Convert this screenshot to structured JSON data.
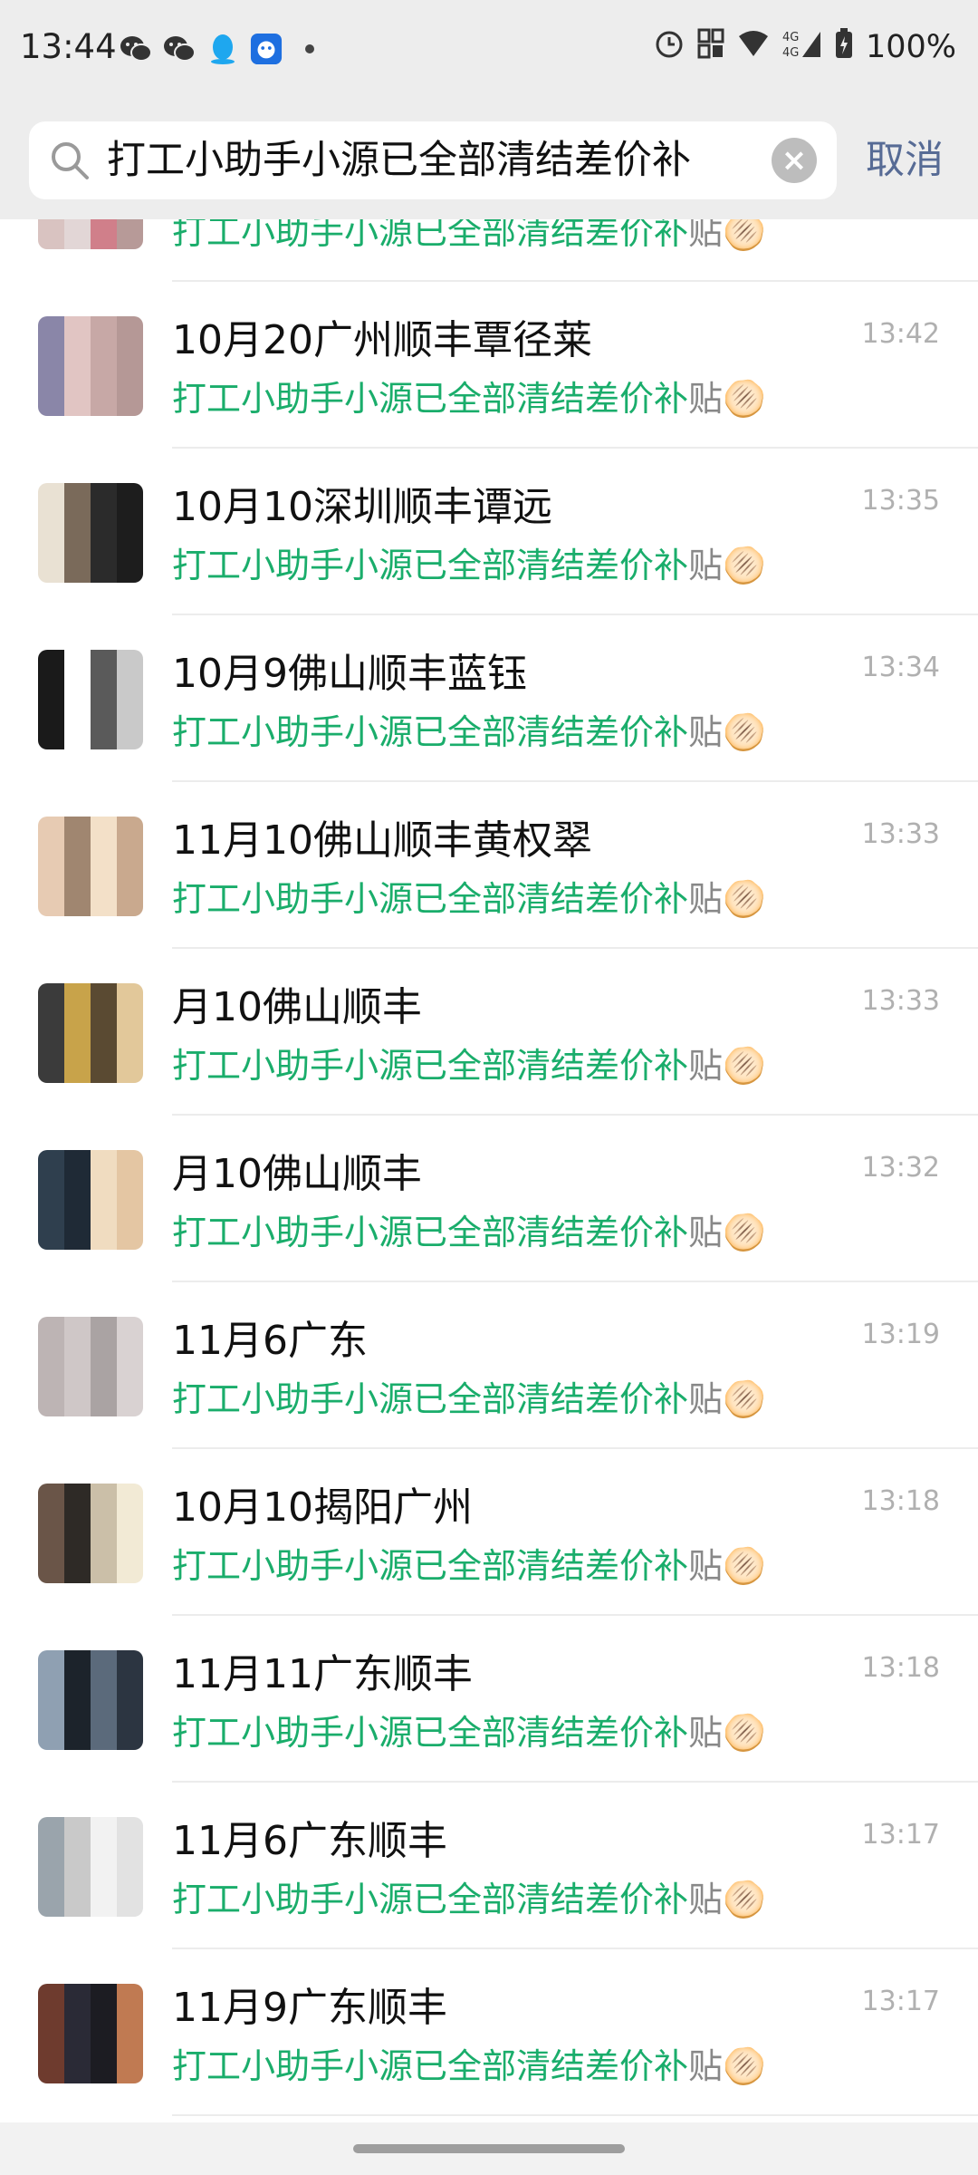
{
  "status_bar": {
    "time": "13:44",
    "left_icons": [
      "wechat-icon",
      "wechat-icon",
      "qq-icon",
      "app-icon",
      "dot-icon"
    ],
    "right_icons": [
      "alarm-icon",
      "nfc-icon",
      "wifi-icon",
      "signal-4g-icon",
      "battery-icon"
    ],
    "battery": "100%"
  },
  "search": {
    "query": "打工小助手小源已全部清结差价补",
    "cancel_label": "取消"
  },
  "results": [
    {
      "title": "",
      "time": "",
      "message": "打工小助手小源已全部清结差价补",
      "suffix": "贴🫓"
    },
    {
      "title": "10月20广州顺丰覃径莱",
      "time": "13:42",
      "message": "打工小助手小源已全部清结差价补",
      "suffix": "贴🫓"
    },
    {
      "title": "10月10深圳顺丰谭远",
      "time": "13:35",
      "message": "打工小助手小源已全部清结差价补",
      "suffix": "贴🫓"
    },
    {
      "title": "10月9佛山顺丰蓝钰",
      "time": "13:34",
      "message": "打工小助手小源已全部清结差价补",
      "suffix": "贴🫓"
    },
    {
      "title": "11月10佛山顺丰黄权翠",
      "time": "13:33",
      "message": "打工小助手小源已全部清结差价补",
      "suffix": "贴🫓"
    },
    {
      "title": "月10佛山顺丰",
      "time": "13:33",
      "message": "打工小助手小源已全部清结差价补",
      "suffix": "贴🫓"
    },
    {
      "title": "月10佛山顺丰",
      "time": "13:32",
      "message": "打工小助手小源已全部清结差价补",
      "suffix": "贴🫓"
    },
    {
      "title": "11月6广东",
      "time": "13:19",
      "message": "打工小助手小源已全部清结差价补",
      "suffix": "贴🫓"
    },
    {
      "title": "10月10揭阳广州",
      "time": "13:18",
      "message": "打工小助手小源已全部清结差价补",
      "suffix": "贴🫓"
    },
    {
      "title": "11月11广东顺丰",
      "time": "13:18",
      "message": "打工小助手小源已全部清结差价补",
      "suffix": "贴🫓"
    },
    {
      "title": "11月6广东顺丰",
      "time": "13:17",
      "message": "打工小助手小源已全部清结差价补",
      "suffix": "贴🫓"
    },
    {
      "title": "11月9广东顺丰",
      "time": "13:17",
      "message": "打工小助手小源已全部清结差价补",
      "suffix": "贴🫓"
    }
  ],
  "avatar_colors": [
    [
      "#d9c3c1",
      "#b79a98",
      "#d07f8a",
      "#e2d6d6"
    ],
    [
      "#b59896",
      "#c7a8a6",
      "#e1c5c3",
      "#8a86a8"
    ],
    [
      "#2b2b2b",
      "#7a6a5a",
      "#e9e1d3",
      "#1d1d1d"
    ],
    [
      "#ffffff",
      "#1a1a1a",
      "#c9c9c9",
      "#5a5a5a"
    ],
    [
      "#e7cbb3",
      "#c9a98e",
      "#f3e0c8",
      "#a08670"
    ],
    [
      "#e2c89a",
      "#5a4a32",
      "#c8a34a",
      "#3b3b3b"
    ],
    [
      "#f0dcc0",
      "#1f2a36",
      "#2f3f4e",
      "#e4c6a3"
    ],
    [
      "#cfc7c7",
      "#bdb4b4",
      "#d9d2d2",
      "#aaa3a3"
    ],
    [
      "#6a5548",
      "#f2ead5",
      "#cbbfa8",
      "#2e2a26"
    ],
    [
      "#2c3541",
      "#5b6a7b",
      "#1c232b",
      "#8fa0b2"
    ],
    [
      "#f2f2f2",
      "#c9c9c9",
      "#9aa4ac",
      "#e2e2e2"
    ],
    [
      "#2a2a36",
      "#6e3b2e",
      "#c07a52",
      "#1c1c22"
    ]
  ]
}
